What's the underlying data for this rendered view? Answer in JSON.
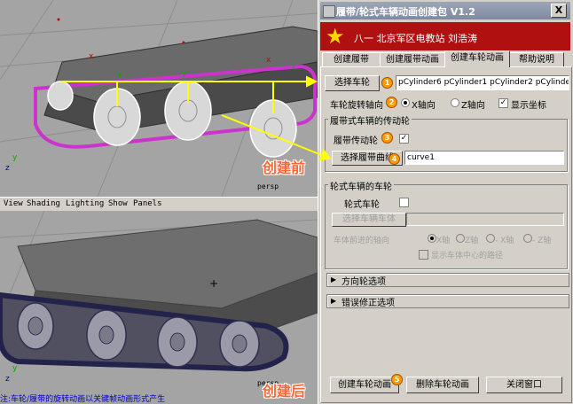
{
  "viewport_top": {
    "camera": "persp",
    "annotation": "创建前",
    "axis_labels": {
      "x": "x",
      "y": "y",
      "z": "z"
    }
  },
  "viewport_menu": [
    "View",
    "Shading",
    "Lighting",
    "Show",
    "Panels"
  ],
  "viewport_bottom": {
    "camera": "persp",
    "annotation": "创建后",
    "status": "注:车轮/履带的旋转动画以关键帧动画形式产生"
  },
  "window": {
    "title": "履带/轮式车辆动画创建包 V1.2",
    "close_glyph": "X",
    "banner_text": "八一   北京军区电教站  刘浩涛",
    "banner_star": "★",
    "tabs": [
      "创建履带",
      "创建履带动画",
      "创建车轮动画",
      "帮助说明"
    ],
    "active_tab": 2
  },
  "panel": {
    "select_wheels_button": "选择车轮",
    "wheels_field": "pCylinder6 pCylinder1 pCylinder2 pCylinder3 p",
    "rotation_axis_label": "车轮旋转轴向",
    "axis_x_label": "X轴向",
    "axis_z_label": "Z轴向",
    "show_axis_label": "显示坐标",
    "show_axis_checked": "✓",
    "tracked_group_title": "履带式车辆的传动轮",
    "track_drive_wheel_label": "履带传动轮",
    "track_drive_checked": "✓",
    "select_track_curve_button": "选择履带曲线",
    "curve_field": "curve1",
    "wheeled_group_title": "轮式车辆的车轮",
    "wheeled_label": "轮式车轮",
    "select_body_button": "选择车辆车体",
    "body_field": "",
    "forward_axis_label": "车体前进的轴向",
    "fwd_options": [
      "X轴",
      "Z轴",
      "- X轴",
      "- Z轴"
    ],
    "show_body_path_label": "显示车体中心的路径",
    "direction_frame": "方向轮选项",
    "error_frame": "错误修正选项",
    "create_button": "创建车轮动画",
    "delete_button": "删除车轮动画",
    "close_button": "关闭窗口",
    "step_numbers": [
      "1",
      "2",
      "3",
      "4",
      "5"
    ]
  },
  "colors": {
    "annotation": "#ff6633",
    "banner": "#b01010",
    "step_badge": "#ff9900",
    "arrow": "#ffff00",
    "track_highlight": "#cc33cc"
  }
}
